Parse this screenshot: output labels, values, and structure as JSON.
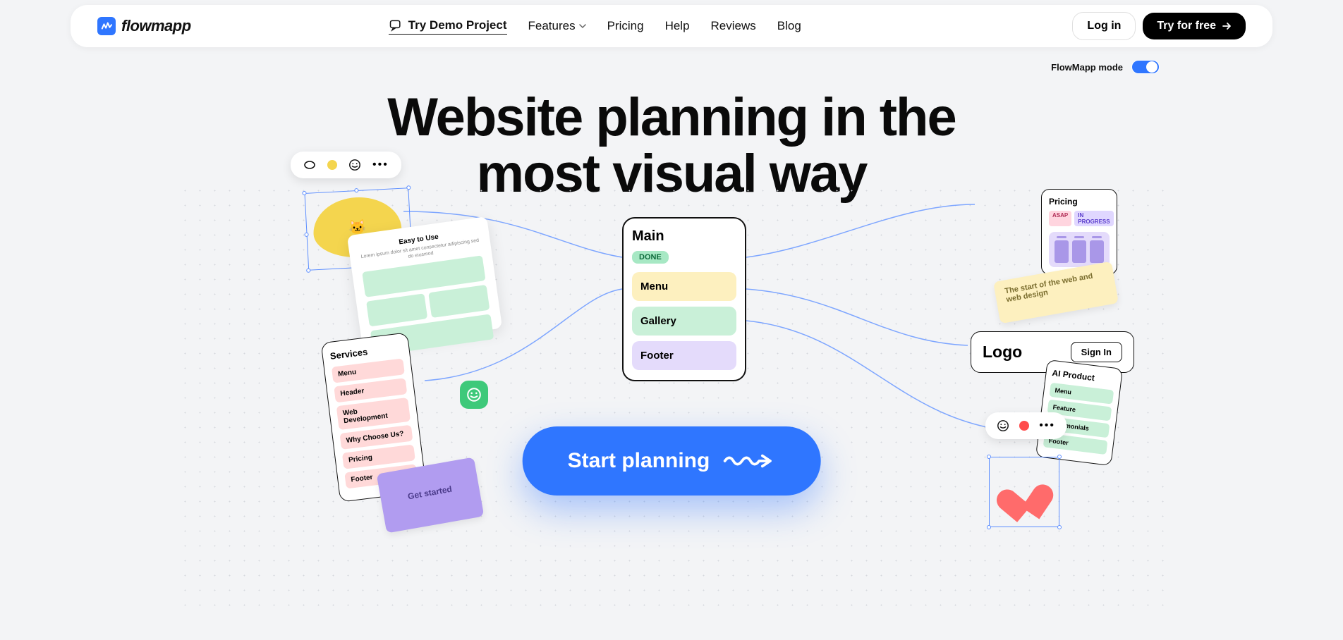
{
  "header": {
    "brand": "flowmapp",
    "try_demo": "Try Demo Project",
    "features": "Features",
    "pricing": "Pricing",
    "help": "Help",
    "reviews": "Reviews",
    "blog": "Blog",
    "login": "Log in",
    "cta": "Try for free"
  },
  "mode": {
    "label": "FlowMapp mode"
  },
  "headline": {
    "line1": "Website planning in the",
    "line2": "most visual way"
  },
  "main_card": {
    "title": "Main",
    "badge": "DONE",
    "blocks": [
      "Menu",
      "Gallery",
      "Footer"
    ]
  },
  "pricing_card": {
    "title": "Pricing",
    "badge_asap": "ASAP",
    "badge_prog": "IN PROGRESS"
  },
  "logo_card": {
    "text": "Logo",
    "btn": "Sign In"
  },
  "services_card": {
    "title": "Services",
    "items": [
      "Menu",
      "Header",
      "Web Development",
      "Why Choose Us?",
      "Pricing",
      "Footer"
    ]
  },
  "ai_card": {
    "title": "AI Product",
    "items": [
      "Menu",
      "Feature",
      "Testimonials",
      "Footer"
    ]
  },
  "wireframe": {
    "title": "Easy to Use",
    "sub": "Lorem ipsum dolor sit amet consectetur adipiscing sed do eiusmod"
  },
  "notes": {
    "yellow": "The start of the web and web design",
    "purple": "Get started"
  },
  "start_btn": "Start planning"
}
